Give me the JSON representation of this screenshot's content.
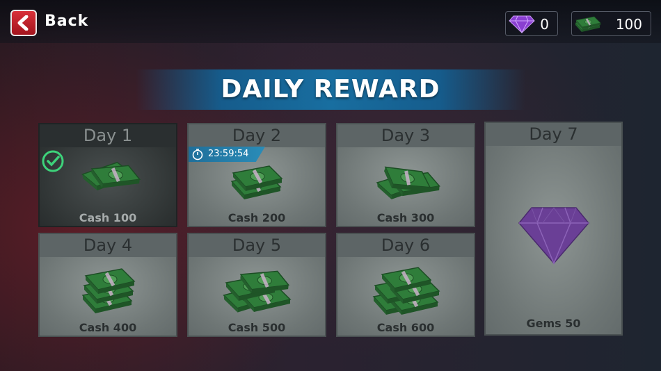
{
  "header": {
    "back_label": "Back",
    "gems": {
      "icon": "purple-gem-icon",
      "value": "0"
    },
    "cash": {
      "icon": "cash-stack-icon",
      "value": "100"
    }
  },
  "title": "DAILY REWARD",
  "rewards": [
    {
      "day": "Day 1",
      "amount": "Cash 100",
      "icon": "cash-stack-icon",
      "claimed": true
    },
    {
      "day": "Day 2",
      "amount": "Cash 200",
      "icon": "cash-stack-icon",
      "timer": "23:59:54"
    },
    {
      "day": "Day 3",
      "amount": "Cash 300",
      "icon": "cash-stack-icon"
    },
    {
      "day": "Day 4",
      "amount": "Cash 400",
      "icon": "cash-stack-icon"
    },
    {
      "day": "Day 5",
      "amount": "Cash 500",
      "icon": "cash-stack-icon"
    },
    {
      "day": "Day 6",
      "amount": "Cash 600",
      "icon": "cash-stack-icon"
    },
    {
      "day": "Day 7",
      "amount": "Gems 50",
      "icon": "purple-gem-icon"
    }
  ],
  "colors": {
    "accent": "#1f6f9a",
    "back_button": "#c8232c",
    "check": "#3dd27a"
  }
}
